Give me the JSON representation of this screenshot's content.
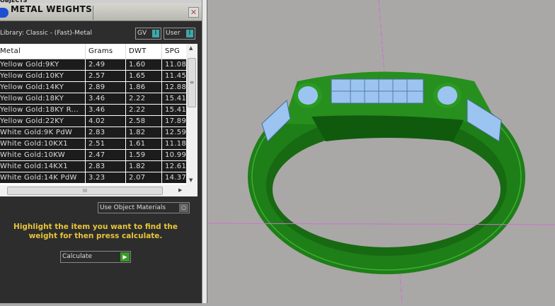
{
  "panel": {
    "top_strip_label": "OBJECTS",
    "title": "METAL WEIGHTS",
    "close_label": "✕",
    "library_label": "Library: Classic - (Fast)-Metal",
    "toggle_gv": "GV",
    "toggle_user": "User",
    "toggle_glyph": "I",
    "table": {
      "columns": [
        "Metal",
        "Grams",
        "DWT",
        "SPG"
      ],
      "rows": [
        [
          "Yellow Gold:9KY",
          "2.49",
          "1.60",
          "11.08"
        ],
        [
          "Yellow Gold:10KY",
          "2.57",
          "1.65",
          "11.45"
        ],
        [
          "Yellow Gold:14KY",
          "2.89",
          "1.86",
          "12.88"
        ],
        [
          "Yellow Gold:18KY",
          "3.46",
          "2.22",
          "15.41"
        ],
        [
          "Yellow Gold:18KY R...",
          "3.46",
          "2.22",
          "15.41"
        ],
        [
          "Yellow Gold:22KY",
          "4.02",
          "2.58",
          "17.89"
        ],
        [
          "White Gold:9K PdW",
          "2.83",
          "1.82",
          "12.59"
        ],
        [
          "White Gold:10KX1",
          "2.51",
          "1.61",
          "11.18"
        ],
        [
          "White Gold:10KW",
          "2.47",
          "1.59",
          "10.99"
        ],
        [
          "White Gold:14KX1",
          "2.83",
          "1.82",
          "12.61"
        ],
        [
          "White Gold:14K PdW",
          "3.23",
          "2.07",
          "14.37"
        ]
      ]
    },
    "use_object_materials": "Use Object Materials",
    "hint": "Highlight the item you want to find the weight for then press calculate.",
    "calculate_label": "Calculate"
  },
  "colors": {
    "ring": "#1f8a1a",
    "stones": "#9cc4f0",
    "axis": "#d070d0",
    "hint": "#e8c43a"
  }
}
